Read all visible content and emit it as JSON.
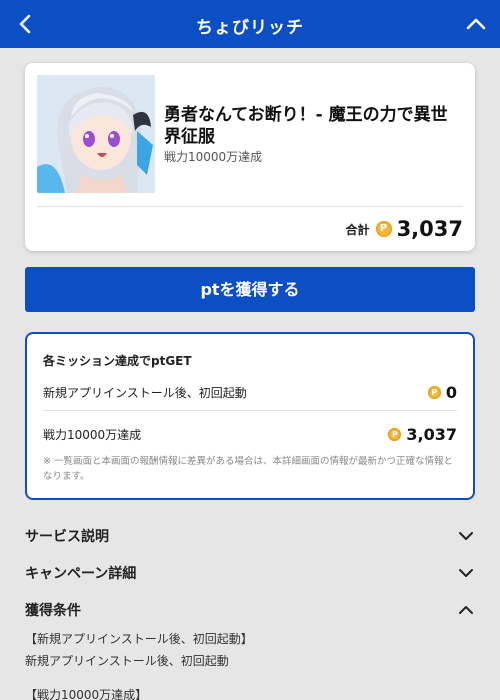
{
  "header": {
    "title": "ちょびリッチ",
    "back_icon": "chevron-left-icon",
    "collapse_icon": "chevron-up-icon",
    "color": "#0c4fc4"
  },
  "offer": {
    "title": "勇者なんてお断り！- 魔王の力で異世界征服",
    "subtitle": "戦力10000万達成",
    "total_label": "合計",
    "coin_symbol": "P",
    "total_points": "3,037"
  },
  "cta": {
    "label": "ptを獲得する"
  },
  "missions": {
    "title": "各ミッション達成でptGET",
    "items": [
      {
        "name": "新規アプリインストール後、初回起動",
        "points": "0"
      },
      {
        "name": "戦力10000万達成",
        "points": "3,037"
      }
    ],
    "note": "※ 一覧画面と本画面の報酬情報に差異がある場合は、本詳細画面の情報が最新かつ正確な情報となります。"
  },
  "sections": [
    {
      "label": "サービス説明",
      "state": "collapsed"
    },
    {
      "label": "キャンペーン詳細",
      "state": "collapsed"
    },
    {
      "label": "獲得条件",
      "state": "expanded"
    }
  ],
  "conditions": {
    "heading1": "【新規アプリインストール後、初回起動】",
    "text1": "新規アプリインストール後、初回起動",
    "heading2": "【戦力10000万達成】"
  },
  "colors": {
    "accent": "#0c4fc4",
    "coin": "#f4b63a",
    "background": "#e6e6e6"
  }
}
